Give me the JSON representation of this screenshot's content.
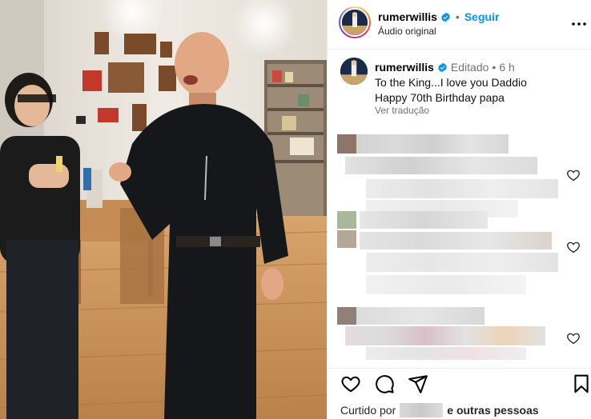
{
  "header": {
    "username": "rumerwillis",
    "separator": "•",
    "follow_label": "Seguir",
    "audio_label": "Áudio original",
    "icons": {
      "verified": "verified-badge-icon",
      "more": "more-options-icon"
    }
  },
  "caption": {
    "username": "rumerwillis",
    "edited_label": "Editado",
    "separator": "•",
    "time": "6 h",
    "line1": "To the King...I love you Daddio",
    "line2": "Happy 70th Birthday papa",
    "translate_label": "Ver tradução"
  },
  "comments": {
    "count_visible": 3,
    "content": "pixelated"
  },
  "actions": {
    "icons": [
      "like-icon",
      "comment-icon",
      "share-icon",
      "save-icon"
    ],
    "liked_prefix": "Curtido por",
    "liked_suffix": "e outras pessoas"
  },
  "colors": {
    "accent": "#0095f6",
    "verified": "#0095f6",
    "muted": "#737373"
  }
}
